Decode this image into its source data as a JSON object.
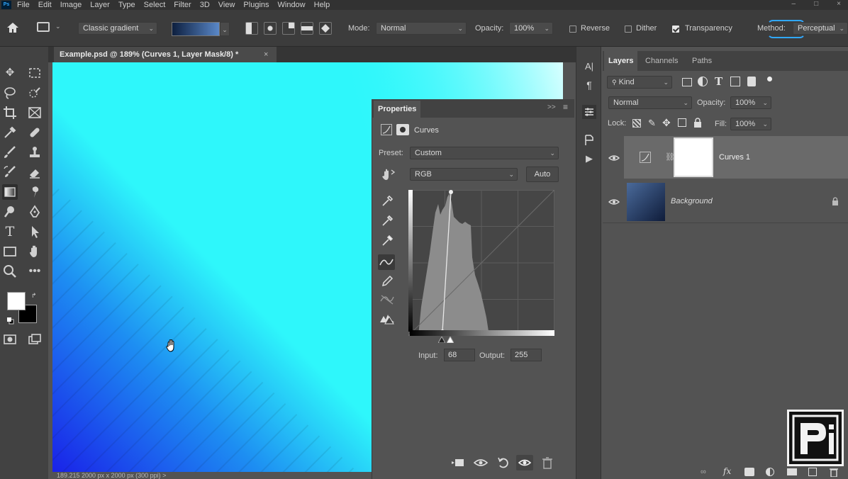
{
  "menu": [
    "File",
    "Edit",
    "Image",
    "Layer",
    "Type",
    "Select",
    "Filter",
    "3D",
    "View",
    "Plugins",
    "Window",
    "Help"
  ],
  "window_controls": [
    "–",
    "□",
    "×"
  ],
  "options": {
    "gradient_preset": "Classic gradient",
    "mode_label": "Mode:",
    "mode_value": "Normal",
    "opacity_label": "Opacity:",
    "opacity_value": "100%",
    "reverse_label": "Reverse",
    "reverse_checked": false,
    "dither_label": "Dither",
    "dither_checked": false,
    "transparency_label": "Transparency",
    "transparency_checked": true,
    "method_label": "Method:",
    "method_value": "Perceptual"
  },
  "document": {
    "tab_title": "Example.psd @ 189% (Curves 1, Layer Mask/8) *",
    "close_glyph": "×",
    "status": "189.215  2000 px x 2000 px (300 ppi)  >"
  },
  "properties": {
    "tab": "Properties",
    "header_label": "Curves",
    "preset_label": "Preset:",
    "preset_value": "Custom",
    "channel_value": "RGB",
    "auto_label": "Auto",
    "input_label": "Input:",
    "input_value": "68",
    "output_label": "Output:",
    "output_value": "255",
    "expand_glyph": ">>"
  },
  "layers_panel": {
    "tabs": [
      "Layers",
      "Channels",
      "Paths"
    ],
    "filter_kind": "Kind",
    "blend_mode": "Normal",
    "opacity_label": "Opacity:",
    "opacity_value": "100%",
    "lock_label": "Lock:",
    "fill_label": "Fill:",
    "fill_value": "100%",
    "layers": [
      {
        "name": "Curves 1",
        "selected": true
      },
      {
        "name": "Background",
        "selected": false
      }
    ]
  },
  "colors": {
    "accent": "#31a8ff",
    "canvas_cyan": "#2ef7fb",
    "canvas_blue": "#1a22e8",
    "panel_bg": "#535353",
    "toolbar_bg": "#424242"
  }
}
